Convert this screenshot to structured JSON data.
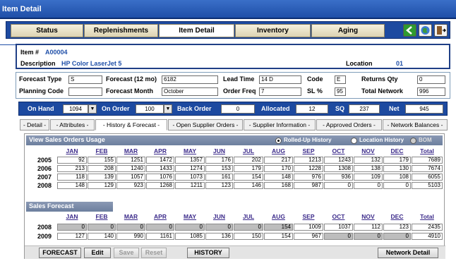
{
  "window": {
    "title": "Item Detail"
  },
  "main_tabs": [
    {
      "label": "Status"
    },
    {
      "label": "Replenishments"
    },
    {
      "label": "Item Detail"
    },
    {
      "label": "Inventory"
    },
    {
      "label": "Aging"
    }
  ],
  "toolbar_icons": [
    "back-arrow-icon",
    "globe-icon",
    "exit-door-icon"
  ],
  "item": {
    "number_label": "Item #",
    "number": "A00004",
    "description_label": "Description",
    "description": "HP Color LaserJet 5",
    "location_label": "Location",
    "location": "01"
  },
  "form": {
    "forecast_type_label": "Forecast Type",
    "forecast_type": "S",
    "forecast12_label": "Forecast (12 mo)",
    "forecast12": "6182",
    "lead_time_label": "Lead Time",
    "lead_time": "14 D",
    "code_label": "Code",
    "code": "E",
    "returns_qty_label": "Returns Qty",
    "returns_qty": "0",
    "planning_code_label": "Planning Code",
    "planning_code": "",
    "forecast_month_label": "Forecast Month",
    "forecast_month": "October",
    "order_freq_label": "Order Freq",
    "order_freq": "7",
    "sl_label": "SL %",
    "sl": "95",
    "total_network_label": "Total Network",
    "total_network": "996"
  },
  "summary": {
    "on_hand_label": "On Hand",
    "on_hand": "1094",
    "on_order_label": "On Order",
    "on_order": "100",
    "back_order_label": "Back Order",
    "back_order": "0",
    "allocated_label": "Allocated",
    "allocated": "12",
    "sq_label": "SQ",
    "sq": "237",
    "net_label": "Net",
    "net": "945"
  },
  "sub_tabs": [
    {
      "label": "- Detail -"
    },
    {
      "label": "- Attributes -"
    },
    {
      "label": "- History & Forecast -"
    },
    {
      "label": "- Open Supplier Orders -"
    },
    {
      "label": "- Supplier Information -"
    },
    {
      "label": "- Approved Orders -"
    },
    {
      "label": "- Network Balances -"
    }
  ],
  "history": {
    "title": "View Sales Orders Usage",
    "radio_rolled": "Rolled-Up History",
    "radio_location": "Location History",
    "radio_bom": "BOM",
    "months": [
      "JAN",
      "FEB",
      "MAR",
      "APR",
      "MAY",
      "JUN",
      "JUL",
      "AUG",
      "SEP",
      "OCT",
      "NOV",
      "DEC",
      "Total"
    ],
    "rows": [
      {
        "year": "2005",
        "values": [
          "92",
          "155",
          "1251",
          "1472",
          "1357",
          "176",
          "202",
          "217",
          "1213",
          "1243",
          "132",
          "179",
          "7689"
        ]
      },
      {
        "year": "2006",
        "values": [
          "213",
          "208",
          "1240",
          "1433",
          "1274",
          "153",
          "179",
          "170",
          "1228",
          "1308",
          "138",
          "130",
          "7674"
        ]
      },
      {
        "year": "2007",
        "values": [
          "118",
          "139",
          "1057",
          "1076",
          "1073",
          "161",
          "154",
          "148",
          "976",
          "936",
          "109",
          "108",
          "6055"
        ]
      },
      {
        "year": "2008",
        "values": [
          "148",
          "129",
          "923",
          "1268",
          "1211",
          "123",
          "146",
          "168",
          "987",
          "0",
          "0",
          "0",
          "5103"
        ]
      }
    ]
  },
  "forecast": {
    "title": "Sales Forecast",
    "months": [
      "JAN",
      "FEB",
      "MAR",
      "APR",
      "MAY",
      "JUN",
      "JUL",
      "AUG",
      "SEP",
      "OCT",
      "NOV",
      "DEC",
      "Total"
    ],
    "rows": [
      {
        "year": "2008",
        "values": [
          "0",
          "0",
          "0",
          "0",
          "0",
          "0",
          "0",
          "154",
          "1009",
          "1037",
          "112",
          "123",
          "2435"
        ]
      },
      {
        "year": "2009",
        "values": [
          "127",
          "140",
          "990",
          "1161",
          "1085",
          "136",
          "150",
          "154",
          "967",
          "0",
          "0",
          "0",
          "4910"
        ]
      }
    ]
  },
  "buttons": {
    "forecast": "FORECAST",
    "edit": "Edit",
    "save": "Save",
    "reset": "Reset",
    "history": "HISTORY",
    "network_detail": "Network Detail"
  }
}
